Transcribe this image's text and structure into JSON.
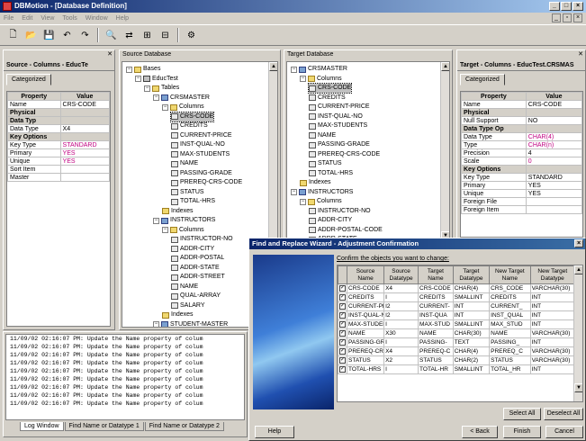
{
  "window": {
    "title": "DBMotion - [Database Definition]"
  },
  "menu": [
    "File",
    "Edit",
    "View",
    "Tools",
    "Window",
    "Help"
  ],
  "left_panel": {
    "title": "Source - Columns - EducTe",
    "tab": "Categorized",
    "headers": [
      "Property",
      "Value"
    ],
    "rows": [
      {
        "p": "Name",
        "v": "CRS-CODE",
        "type": "val"
      },
      {
        "p": "Physical",
        "v": "",
        "type": "sec"
      },
      {
        "p": "Data Typ",
        "v": "",
        "type": "sec"
      },
      {
        "p": "Data Type",
        "v": "X4",
        "type": "val"
      },
      {
        "p": "Key Options",
        "v": "",
        "type": "sec"
      },
      {
        "p": "Key Type",
        "v": "STANDARD",
        "type": "red"
      },
      {
        "p": "Primary",
        "v": "YES",
        "type": "red"
      },
      {
        "p": "Unique",
        "v": "YES",
        "type": "red"
      },
      {
        "p": "Sort Item",
        "v": "",
        "type": "val"
      },
      {
        "p": "Master",
        "v": "",
        "type": "val"
      }
    ]
  },
  "source_db": {
    "title": "Source Database",
    "nodes": [
      "Bases",
      "EducTest",
      "Tables",
      "CRSMASTER",
      "Columns",
      "CRS-CODE",
      "CREDITS",
      "CURRENT-PRICE",
      "INST-QUAL-NO",
      "MAX-STUDENTS",
      "NAME",
      "PASSING-GRADE",
      "PREREQ-CRS-CODE",
      "STATUS",
      "TOTAL-HRS",
      "Indexes",
      "INSTRUCTORS",
      "Columns",
      "INSTRUCTOR-NO",
      "ADDR-CITY",
      "ADDR-POSTAL",
      "ADDR-STATE",
      "ADDR-STREET",
      "NAME",
      "QUAL-ARRAY",
      "SALARY",
      "Indexes",
      "STUDENT-MASTER"
    ]
  },
  "target_db": {
    "title": "Target Database",
    "nodes": [
      "CRSMASTER",
      "Columns",
      "CRS-CODE",
      "CREDITS",
      "CURRENT-PRICE",
      "INST-QUAL-NO",
      "MAX-STUDENTS",
      "NAME",
      "PASSING-GRADE",
      "PREREQ-CRS-CODE",
      "STATUS",
      "TOTAL-HRS",
      "Indexes",
      "INSTRUCTORS",
      "Columns",
      "INSTRUCTOR-NO",
      "ADDR-CITY",
      "ADDR-POSTAL-CODE",
      "ADDR-STATE"
    ]
  },
  "right_panel": {
    "title": "Target - Columns - EducTest.CRSMAS",
    "tab": "Categorized",
    "headers": [
      "Property",
      "Value"
    ],
    "rows": [
      {
        "p": "Name",
        "v": "CRS-CODE",
        "type": "val"
      },
      {
        "p": "Physical",
        "v": "",
        "type": "sec"
      },
      {
        "p": "Null Support",
        "v": "NO",
        "type": "val"
      },
      {
        "p": "Data Type Op",
        "v": "",
        "type": "sec"
      },
      {
        "p": "Data Type",
        "v": "CHAR(4)",
        "type": "red"
      },
      {
        "p": "Type",
        "v": "CHAR(n)",
        "type": "red"
      },
      {
        "p": "Precision",
        "v": "4",
        "type": "val"
      },
      {
        "p": "Scale",
        "v": "0",
        "type": "red"
      },
      {
        "p": "Key Options",
        "v": "",
        "type": "sec"
      },
      {
        "p": "Key Type",
        "v": "STANDARD",
        "type": "val"
      },
      {
        "p": "Primary",
        "v": "YES",
        "type": "val"
      },
      {
        "p": "Unique",
        "v": "YES",
        "type": "val"
      },
      {
        "p": "Foreign File",
        "v": "",
        "type": "val"
      },
      {
        "p": "Foreign Item",
        "v": "",
        "type": "val"
      }
    ]
  },
  "log": {
    "lines": [
      "11/09/02 02:16:07 PM: Update the Name property of colum",
      "11/09/02 02:16:07 PM: Update the Name property of colum",
      "11/09/02 02:16:07 PM: Update the Name property of colum",
      "11/09/02 02:16:07 PM: Update the Name property of colum",
      "11/09/02 02:16:07 PM: Update the Name property of colum",
      "11/09/02 02:16:07 PM: Update the Name property of colum",
      "11/09/02 02:16:07 PM: Update the Name property of colum",
      "11/09/02 02:16:07 PM: Update the Name property of colum",
      "11/09/02 02:16:07 PM: Update the Name property of colum"
    ],
    "tabs": [
      "Log Window",
      "Find Name or Datatype 1",
      "Find Name or Datatype 2"
    ]
  },
  "dialog": {
    "title": "Find and Replace Wizard - Adjustment Confirmation",
    "prompt": "Confirm the objects you want to change:",
    "headers": [
      "Source Name",
      "Source Datatype",
      "Target Name",
      "Target Datatype",
      "New Target Name",
      "New Target Datatype"
    ],
    "rows": [
      [
        "CRS-CODE",
        "X4",
        "CRS-CODE",
        "CHAR(4)",
        "CRS_CODE",
        "VARCHAR(30)"
      ],
      [
        "CREDITS",
        "I",
        "CREDITS",
        "SMALLINT",
        "CREDITS",
        "INT"
      ],
      [
        "CURRENT-PRI",
        "I2",
        "CURRENT-",
        "INT",
        "CURRENT_",
        "INT"
      ],
      [
        "INST-QUAL-NO",
        "I2",
        "INST-QUA",
        "INT",
        "INST_QUAL",
        "INT"
      ],
      [
        "MAX-STUDENT",
        "I",
        "MAX-STUD",
        "SMALLINT",
        "MAX_STUD",
        "INT"
      ],
      [
        "NAME",
        "X30",
        "NAME",
        "CHAR(30)",
        "NAME",
        "VARCHAR(30)"
      ],
      [
        "PASSING-GRA",
        "I",
        "PASSING-",
        "TEXT",
        "PASSING_",
        "INT"
      ],
      [
        "PREREQ-CRS-C",
        "X4",
        "PREREQ-C",
        "CHAR(4)",
        "PREREQ_C",
        "VARCHAR(30)"
      ],
      [
        "STATUS",
        "X2",
        "STATUS",
        "CHAR(2)",
        "STATUS",
        "VARCHAR(30)"
      ],
      [
        "TOTAL-HRS",
        "I",
        "TOTAL-HR",
        "SMALLINT",
        "TOTAL_HR",
        "INT"
      ]
    ],
    "buttons": {
      "select_all": "Select All",
      "deselect_all": "Deselect All",
      "help": "Help",
      "back": "< Back",
      "finish": "Finish",
      "cancel": "Cancel"
    }
  }
}
